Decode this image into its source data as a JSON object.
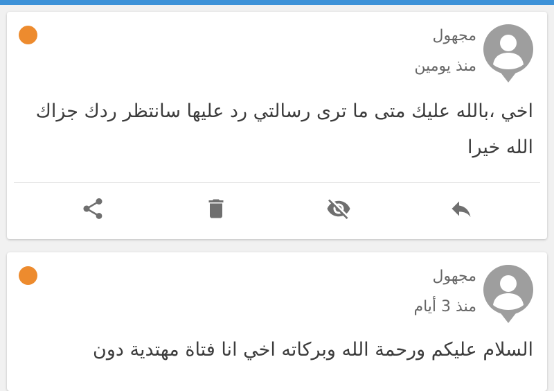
{
  "theme": {
    "accent": "#3d92d8",
    "unread_dot": "#ed8b2e",
    "icon_color": "#6f6f6f",
    "text_color": "#3c3c3c",
    "meta_color": "#666666"
  },
  "messages": [
    {
      "author": "مجهول",
      "time": "منذ يومين",
      "text": "اخي ،بالله عليك متى ما ترى رسالتي رد عليها سانتظر ردك جزاك الله خيرا",
      "unread": true,
      "actions": [
        {
          "name": "share",
          "icon": "share-icon"
        },
        {
          "name": "delete",
          "icon": "trash-icon"
        },
        {
          "name": "hide",
          "icon": "eye-off-icon"
        },
        {
          "name": "reply",
          "icon": "reply-icon"
        }
      ]
    },
    {
      "author": "مجهول",
      "time": "منذ 3 أيام",
      "text": "السلام عليكم ورحمة الله وبركاته اخي انا فتاة مهتدية دون",
      "unread": true
    }
  ]
}
